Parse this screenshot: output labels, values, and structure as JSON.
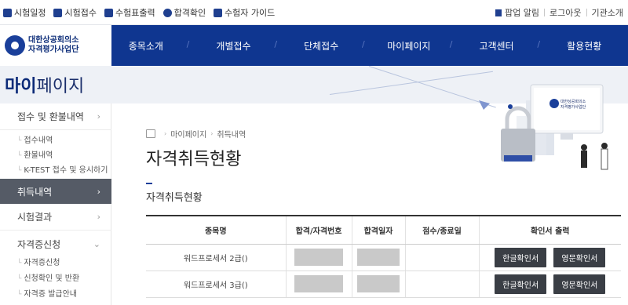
{
  "util_bar": {
    "left_links": [
      {
        "label": "시험일정",
        "icon": "calendar-icon"
      },
      {
        "label": "시험접수",
        "icon": "edit-icon"
      },
      {
        "label": "수험표출력",
        "icon": "ticket-icon"
      },
      {
        "label": "합격확인",
        "icon": "person-icon"
      },
      {
        "label": "수험자 가이드",
        "icon": "book-icon"
      }
    ],
    "right_links": [
      "팝업 알림",
      "로그아웃",
      "기관소개"
    ]
  },
  "header": {
    "logo_line1": "대한상공회의소",
    "logo_line2": "자격평가사업단",
    "nav": [
      "종목소개",
      "개별접수",
      "단체접수",
      "마이페이지",
      "고객센터",
      "활용현황"
    ]
  },
  "band": {
    "title_bold": "마이",
    "title_rest": "페이지"
  },
  "sidebar": {
    "section1": "접수 및 환불내역",
    "section1_items": [
      "접수내역",
      "환불내역",
      "K-TEST 접수 및 응시하기"
    ],
    "active": "취득내역",
    "section3": "시험결과",
    "section4": "자격증신청",
    "section4_items": [
      "자격증신청",
      "신청확인 및 반환",
      "자격증 발급안내"
    ]
  },
  "breadcrumb": {
    "level1": "마이페이지",
    "level2": "취득내역"
  },
  "page_title": "자격취득현황",
  "subheading": "자격취득현황",
  "table": {
    "headers": [
      "종목명",
      "합격/자격번호",
      "합격일자",
      "점수/종료일",
      "확인서 출력"
    ],
    "rows": [
      {
        "name": "워드프로세서 2급()",
        "score": "",
        "btn_kr": "한글확인서",
        "btn_en": "영문확인서"
      },
      {
        "name": "워드프로세서 3급()",
        "score": "",
        "btn_kr": "한글확인서",
        "btn_en": "영문확인서"
      }
    ]
  },
  "illustration": {
    "sign_line1": "대한상공회의소",
    "sign_line2": "자격평가사업단"
  },
  "colors": {
    "brand_navy": "#0f3690",
    "band_bg": "#eef1f6",
    "sidebar_active": "#555b66",
    "button_dark": "#3a3e45"
  }
}
